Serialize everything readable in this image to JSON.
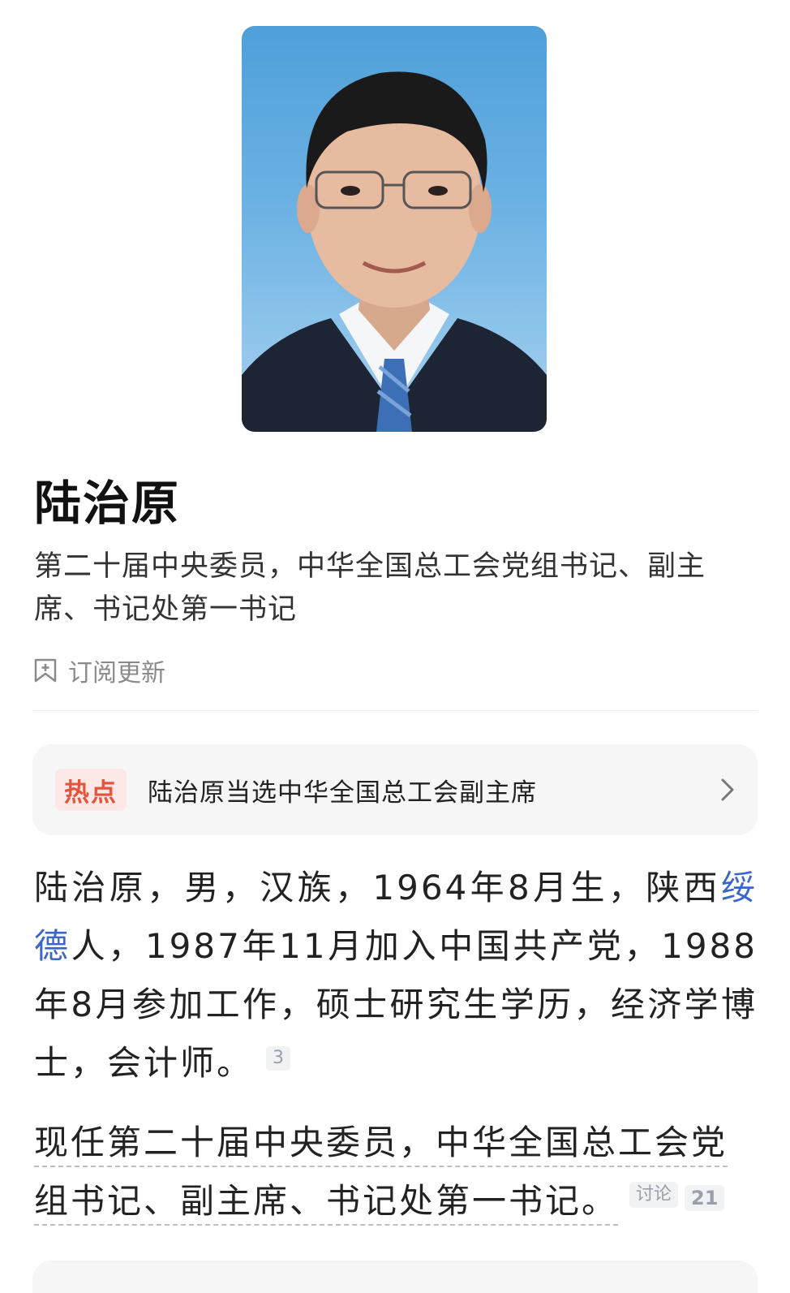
{
  "profile": {
    "name": "陆治原",
    "subtitle": "第二十届中央委员，中华全国总工会党组书记、副主席、书记处第一书记",
    "subscribe_label": "订阅更新"
  },
  "hot": {
    "tag": "热点",
    "headline": "陆治原当选中华全国总工会副主席"
  },
  "bio": {
    "part1": "陆治原，男，汉族，1964年8月生，陕西",
    "link": "绥德",
    "part2": "人，1987年11月加入中国共产党，1988年8月参加工作，硕士研究生学历，经济学博士，会计师。",
    "ref": "3"
  },
  "current": {
    "text": "现任第二十届中央委员，中华全国总工会党组书记、副主席、书记处第一书记。",
    "discuss_label": "讨论",
    "discuss_count": "21"
  },
  "colors": {
    "link": "#3a66c9",
    "hot_tag_bg": "#fde8e8",
    "hot_tag_text": "#e5533d",
    "portrait_bg": "#5aa6de"
  },
  "icons": {
    "subscribe": "bookmark-plus-icon",
    "hot_card_arrow": "chevron-right-icon"
  }
}
